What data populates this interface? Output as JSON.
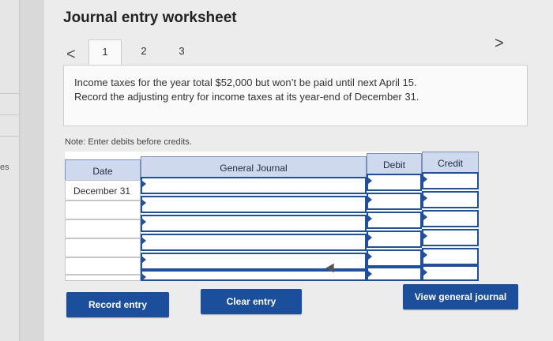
{
  "header": {
    "title": "Journal entry worksheet",
    "prev_symbol": "<",
    "next_symbol": ">",
    "tabs": [
      {
        "label": "1"
      },
      {
        "label": "2"
      },
      {
        "label": "3"
      }
    ]
  },
  "left_strip": {
    "text": "es"
  },
  "question": {
    "line1": "Income taxes for the year total $52,000 but won’t be paid until next April 15.",
    "line2": "Record the adjusting entry for income taxes at its year-end of December 31."
  },
  "note": "Note: Enter debits before credits.",
  "journal": {
    "headers": {
      "date": "Date",
      "account": "General Journal",
      "debit": "Debit",
      "credit": "Credit"
    },
    "rows": [
      {
        "date": "December 31",
        "account": "",
        "debit": "",
        "credit": ""
      },
      {
        "date": "",
        "account": "",
        "debit": "",
        "credit": ""
      },
      {
        "date": "",
        "account": "",
        "debit": "",
        "credit": ""
      },
      {
        "date": "",
        "account": "",
        "debit": "",
        "credit": ""
      },
      {
        "date": "",
        "account": "",
        "debit": "",
        "credit": ""
      },
      {
        "date": "",
        "account": "",
        "debit": "",
        "credit": ""
      }
    ]
  },
  "buttons": {
    "record": "Record entry",
    "clear": "Clear entry",
    "view": "View general journal"
  }
}
